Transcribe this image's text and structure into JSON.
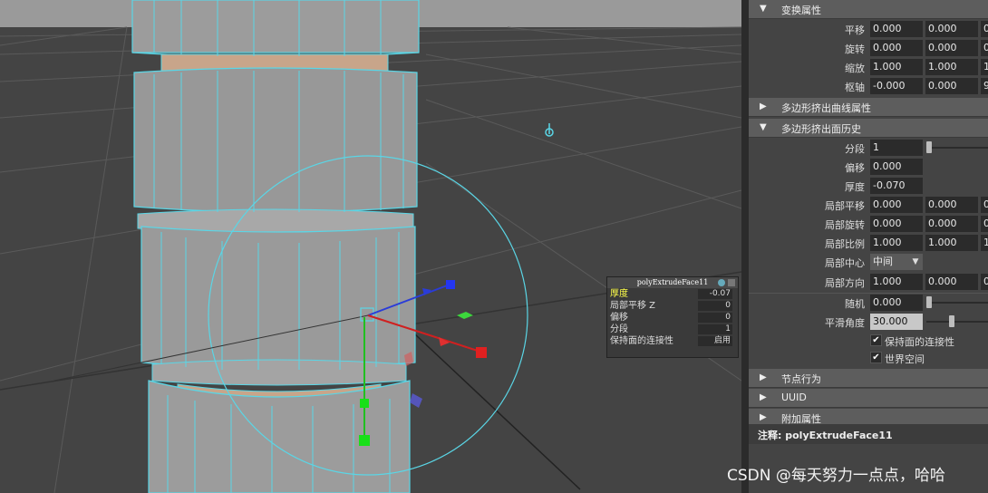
{
  "viewport": {
    "icons": [
      "transform-gizmo",
      "light-locator-icon"
    ]
  },
  "hud": {
    "title": "polyExtrudeFace11",
    "rows": [
      {
        "label": "厚度",
        "value": "-0.07"
      },
      {
        "label": "局部平移 Z",
        "value": "0"
      },
      {
        "label": "偏移",
        "value": "0"
      },
      {
        "label": "分段",
        "value": "1"
      },
      {
        "label": "保持面的连接性",
        "value": "启用"
      }
    ]
  },
  "transform": {
    "header": "变换属性",
    "translate": {
      "label": "平移",
      "values": [
        "0.000",
        "0.000",
        "0"
      ]
    },
    "rotate": {
      "label": "旋转",
      "values": [
        "0.000",
        "0.000",
        "0"
      ]
    },
    "scale": {
      "label": "缩放",
      "values": [
        "1.000",
        "1.000",
        "1"
      ]
    },
    "pivot": {
      "label": "枢轴",
      "values": [
        "-0.000",
        "0.000",
        "9"
      ]
    }
  },
  "curve_section": {
    "header": "多边形挤出曲线属性"
  },
  "history": {
    "header": "多边形挤出面历史",
    "divisions": {
      "label": "分段",
      "value": "1"
    },
    "offset": {
      "label": "偏移",
      "value": "0.000"
    },
    "thickness": {
      "label": "厚度",
      "value": "-0.070"
    },
    "local_translate": {
      "label": "局部平移",
      "values": [
        "0.000",
        "0.000",
        "0"
      ]
    },
    "local_rotate": {
      "label": "局部旋转",
      "values": [
        "0.000",
        "0.000",
        "0"
      ]
    },
    "local_scale": {
      "label": "局部比例",
      "values": [
        "1.000",
        "1.000",
        "1"
      ]
    },
    "local_center": {
      "label": "局部中心",
      "value": "中间"
    },
    "local_direction": {
      "label": "局部方向",
      "values": [
        "1.000",
        "0.000",
        "0"
      ]
    },
    "random": {
      "label": "随机",
      "value": "0.000"
    },
    "smoothing_angle": {
      "label": "平滑角度",
      "value": "30.000"
    },
    "keep_faces_together": {
      "label": "保持面的连接性",
      "checked": "✔"
    },
    "world_space": {
      "label": "世界空间",
      "checked": "✔"
    }
  },
  "collapsed_sections": [
    "节点行为",
    "UUID",
    "附加属性"
  ],
  "note": {
    "label": "注释:",
    "value": "polyExtrudeFace11"
  },
  "watermark": "CSDN @每天努力一点点，哈哈"
}
